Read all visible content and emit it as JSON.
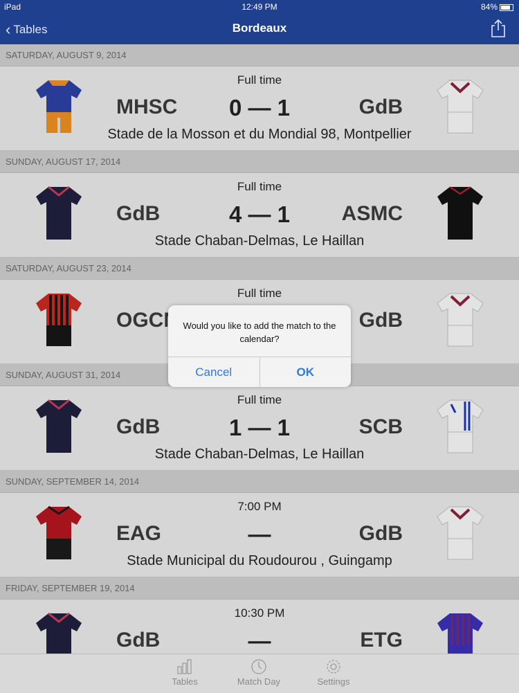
{
  "status_bar": {
    "device": "iPad",
    "time": "12:49 PM",
    "battery": "84%"
  },
  "nav": {
    "back_label": "Tables",
    "title": "Bordeaux"
  },
  "sections": [
    {
      "date": "SATURDAY, AUGUST 9, 2014",
      "match": {
        "status": "Full time",
        "home": "MHSC",
        "score": "0 — 1",
        "away": "GdB",
        "venue": "Stade de la Mosson et du Mondial 98, Montpellier"
      }
    },
    {
      "date": "SUNDAY, AUGUST 17, 2014",
      "match": {
        "status": "Full time",
        "home": "GdB",
        "score": "4 — 1",
        "away": "ASMC",
        "venue": "Stade Chaban-Delmas, Le Haillan"
      }
    },
    {
      "date": "SATURDAY, AUGUST 23, 2014",
      "match": {
        "status": "Full time",
        "home": "OGCN",
        "score": "",
        "away": "GdB",
        "venue": ""
      }
    },
    {
      "date": "SUNDAY, AUGUST 31, 2014",
      "match": {
        "status": "Full time",
        "home": "GdB",
        "score": "1 — 1",
        "away": "SCB",
        "venue": "Stade Chaban-Delmas, Le Haillan"
      }
    },
    {
      "date": "SUNDAY, SEPTEMBER 14, 2014",
      "match": {
        "status": "7:00 PM",
        "home": "EAG",
        "score": "—",
        "away": "GdB",
        "venue": "Stade Municipal du Roudourou , Guingamp"
      }
    },
    {
      "date": "FRIDAY, SEPTEMBER 19, 2014",
      "match": {
        "status": "10:30 PM",
        "home": "GdB",
        "score": "—",
        "away": "ETG",
        "venue": ""
      }
    }
  ],
  "alert": {
    "message": "Would you like to add the match to the calendar?",
    "cancel_label": "Cancel",
    "ok_label": "OK"
  },
  "tabs": [
    {
      "label": "Tables",
      "icon": "bar-chart-icon"
    },
    {
      "label": "Match Day",
      "icon": "clock-icon"
    },
    {
      "label": "Settings",
      "icon": "gear-icon"
    }
  ],
  "colors": {
    "nav": "#1f3f8f",
    "alert_button": "#2a7ae2"
  }
}
